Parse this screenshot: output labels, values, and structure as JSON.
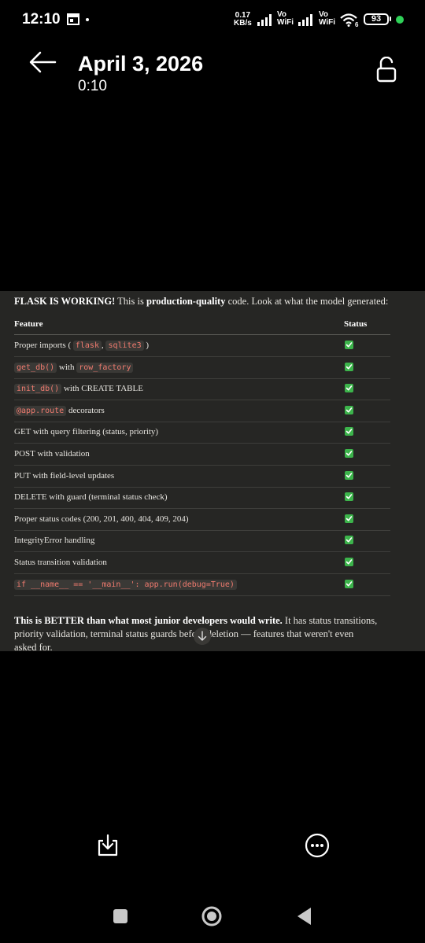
{
  "status_bar": {
    "time": "12:10",
    "speed_value": "0.17",
    "speed_unit": "KB/s",
    "sim1_top": "Vo",
    "sim1_bottom": "WiFi",
    "sim2_top": "Vo",
    "sim2_bottom": "WiFi",
    "wifi_badge": "6",
    "battery": "93"
  },
  "header": {
    "title": "April 3, 2026",
    "subtitle": "0:10"
  },
  "document": {
    "intro": {
      "part1": "FLASK IS WORKING!",
      "part2": " This is ",
      "part3": "production-quality",
      "part4": " code. Look at what the model generated:"
    },
    "table": {
      "col_feature": "Feature",
      "col_status": "Status",
      "rows": [
        {
          "code1": "",
          "text": "Proper imports ( ",
          "code2": "flask",
          "text2": ", ",
          "code3": "sqlite3",
          "text3": " )"
        },
        {
          "code1": "get_db()",
          "text": " with ",
          "code2": "row_factory",
          "text2": "",
          "code3": "",
          "text3": ""
        },
        {
          "code1": "init_db()",
          "text": " with CREATE TABLE",
          "code2": "",
          "text2": "",
          "code3": "",
          "text3": ""
        },
        {
          "code1": "@app.route",
          "text": " decorators",
          "code2": "",
          "text2": "",
          "code3": "",
          "text3": ""
        },
        {
          "code1": "",
          "text": "GET with query filtering (status, priority)",
          "code2": "",
          "text2": "",
          "code3": "",
          "text3": ""
        },
        {
          "code1": "",
          "text": "POST with validation",
          "code2": "",
          "text2": "",
          "code3": "",
          "text3": ""
        },
        {
          "code1": "",
          "text": "PUT with field-level updates",
          "code2": "",
          "text2": "",
          "code3": "",
          "text3": ""
        },
        {
          "code1": "",
          "text": "DELETE with guard (terminal status check)",
          "code2": "",
          "text2": "",
          "code3": "",
          "text3": ""
        },
        {
          "code1": "",
          "text": "Proper status codes (200, 201, 400, 404, 409, 204)",
          "code2": "",
          "text2": "",
          "code3": "",
          "text3": ""
        },
        {
          "code1": "",
          "text": "IntegrityError handling",
          "code2": "",
          "text2": "",
          "code3": "",
          "text3": ""
        },
        {
          "code1": "",
          "text": "Status transition validation",
          "code2": "",
          "text2": "",
          "code3": "",
          "text3": ""
        },
        {
          "code1": "if __name__ == '__main__': app.run(debug=True)",
          "text": "",
          "code2": "",
          "text2": "",
          "code3": "",
          "text3": ""
        }
      ]
    },
    "outro": {
      "bold": "This is BETTER than what most junior developers would write.",
      "line1_rest": " It has status transitions,",
      "line2": "priority validation, terminal status guards before deletion — features that weren't even",
      "line3": "asked for."
    }
  },
  "colors": {
    "background": "#000000",
    "doc_background": "#262624",
    "code_text": "#f07b6f",
    "check_green": "#3cb44b"
  },
  "icons": [
    "back-arrow-icon",
    "unlock-icon",
    "download-icon",
    "more-options-icon",
    "scroll-down-icon"
  ]
}
